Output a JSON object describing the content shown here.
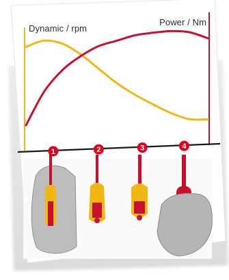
{
  "chart_data": {
    "type": "line",
    "left_axis_label": "Dynamic / rpm",
    "right_axis_label": "Power / Nm",
    "x_categories": [
      "1",
      "2",
      "3",
      "4"
    ],
    "x_range": [
      0,
      100
    ],
    "y_range": [
      0,
      100
    ],
    "series": [
      {
        "label_ref": "Dynamic / rpm",
        "color": "#f2b713",
        "x": [
          0,
          10,
          20,
          30,
          40,
          50,
          60,
          70,
          80,
          90,
          100
        ],
        "y": [
          88,
          94,
          90,
          78,
          62,
          46,
          33,
          22,
          12,
          5,
          4
        ]
      },
      {
        "label_ref": "Power / Nm",
        "color": "#c8102e",
        "x": [
          0,
          10,
          20,
          30,
          40,
          50,
          60,
          70,
          80,
          90,
          100
        ],
        "y": [
          5,
          40,
          62,
          76,
          86,
          91,
          96,
          98,
          99,
          97,
          90
        ]
      }
    ],
    "markers": [
      {
        "label": "1",
        "x": 15
      },
      {
        "label": "2",
        "x": 40
      },
      {
        "label": "3",
        "x": 64
      },
      {
        "label": "4",
        "x": 87
      }
    ],
    "grid": false,
    "legend": "none"
  },
  "colors": {
    "marker_fill": "#e2001a",
    "axis": "#1a1a1a",
    "yellow": "#f2b713",
    "red": "#c8102e"
  },
  "images": {
    "description_icon": "hands-holding-screwdrivers-photo"
  }
}
